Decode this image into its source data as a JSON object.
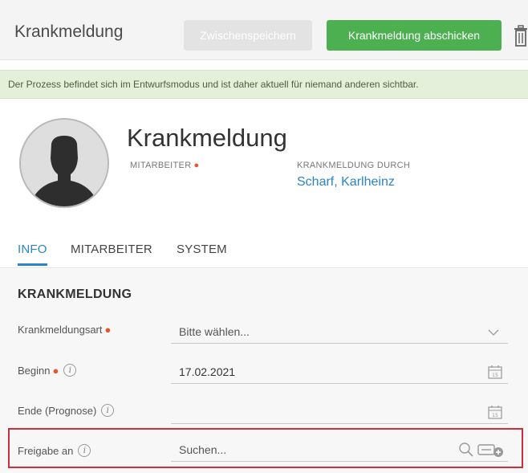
{
  "header": {
    "title": "Krankmeldung",
    "draft_button": "Zwischenspeichern",
    "submit_button": "Krankmeldung abschicken"
  },
  "banner": {
    "text": "Der Prozess befindet sich im Entwurfsmodus und ist daher aktuell für niemand anderen sichtbar."
  },
  "profile": {
    "title": "Krankmeldung",
    "employee_label": "MITARBEITER",
    "reported_by_label": "KRANKMELDUNG DURCH",
    "reported_by_name": "Scharf, Karlheinz"
  },
  "tabs": [
    {
      "label": "INFO",
      "active": true
    },
    {
      "label": "MITARBEITER",
      "active": false
    },
    {
      "label": "SYSTEM",
      "active": false
    }
  ],
  "form": {
    "section_title": "KRANKMELDUNG",
    "rows": [
      {
        "label": "Krankmeldungsart",
        "value": "Bitte wählen..."
      },
      {
        "label": "Beginn",
        "value": "17.02.2021"
      },
      {
        "label": "Ende (Prognose)",
        "value": ""
      },
      {
        "label": "Freigabe an",
        "value": "Suchen..."
      }
    ]
  },
  "icons": {
    "info_glyph": "i",
    "calendar_day": "15"
  },
  "colors": {
    "accent": "#2a86c7",
    "submit": "#4caf50",
    "required": "#e4572e",
    "highlight": "#cc2e3b",
    "banner_bg": "#e4f0d9"
  }
}
